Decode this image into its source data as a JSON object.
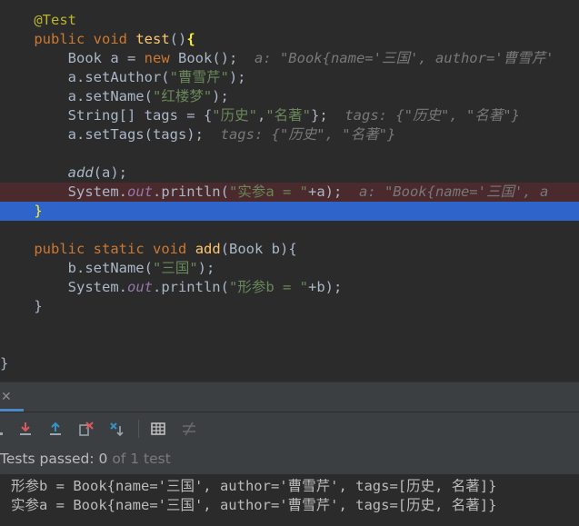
{
  "code": {
    "l1": {
      "ann": "@Test"
    },
    "l2": {
      "kw": "public",
      "kw2": "void",
      "fn": "test",
      "paren": "()",
      "brace": "{"
    },
    "l3": {
      "pre": "Book a = ",
      "kw": "new",
      "post": " Book();",
      "hint": "a: \"Book{name='三国', author='曹雪芹'"
    },
    "l4": {
      "pre": "a.setAuthor(",
      "str": "\"曹雪芹\"",
      "post": ");"
    },
    "l5": {
      "pre": "a.setName(",
      "str": "\"红楼梦\"",
      "post": ");"
    },
    "l6": {
      "pre": "String[] tags = {",
      "str1": "\"历史\"",
      "comma": ",",
      "str2": "\"名著\"",
      "post": "};",
      "hint": "tags: {\"历史\", \"名著\"}"
    },
    "l7": {
      "pre": "a.setTags(tags);",
      "hint": "tags: {\"历史\", \"名著\"}"
    },
    "l9": {
      "fn": "add",
      "post": "(a);"
    },
    "l10": {
      "pre": "System.",
      "static": "out",
      "mid": ".println(",
      "str": "\"实参a = \"",
      "post": "+a);",
      "hint": "a: \"Book{name='三国', a"
    },
    "l11": {
      "brace": "}"
    },
    "l13": {
      "kw": "public",
      "kw2": "static",
      "kw3": "void",
      "fn": "add",
      "post": "(Book b){"
    },
    "l14": {
      "pre": "b.setName(",
      "str": "\"三国\"",
      "post": ");"
    },
    "l15": {
      "pre": "System.",
      "static": "out",
      "mid": ".println(",
      "str": "\"形参b = \"",
      "post": "+b);"
    },
    "l16": {
      "brace": "}"
    },
    "l19": {
      "brace": "}"
    }
  },
  "status": {
    "prefix": "Tests passed: ",
    "passed": "0",
    "of_text": " of ",
    "total": "1 test"
  },
  "console": {
    "line1": "形参b = Book{name='三国', author='曹雪芹', tags=[历史, 名著]}",
    "line2": "实参a = Book{name='三国', author='曹雪芹', tags=[历史, 名著]}"
  },
  "colors": {
    "background": "#2b2b2b",
    "keyword": "#cc7832",
    "string": "#6a8759",
    "function": "#ffc66d",
    "current_line": "#2f65ca",
    "error_line": "#4a2a2c"
  },
  "icons": {
    "close": "close-icon",
    "import": "import-tests-icon",
    "export": "export-tests-icon",
    "rerun_failed": "rerun-failed-icon",
    "sort": "sort-icon",
    "table": "table-icon",
    "collapse": "collapse-icon"
  }
}
